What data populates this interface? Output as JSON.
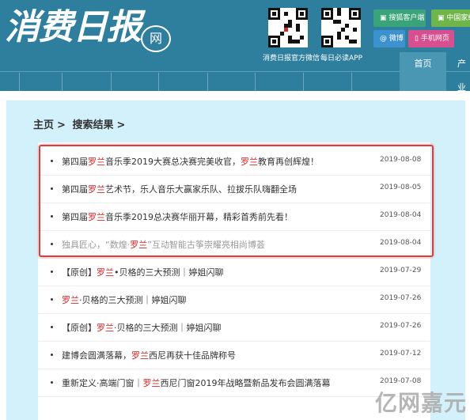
{
  "header": {
    "logo_text": "消费日报",
    "logo_badge": "网",
    "qr_codes": [
      {
        "caption": "消费日报官方微信"
      },
      {
        "caption": "每日必读APP"
      }
    ],
    "buttons": [
      {
        "label": "搜狐客户端",
        "icon": "sohu-client-icon",
        "color": "#3aa37a"
      },
      {
        "label": "中国家纺",
        "icon": "home-textile-icon",
        "color": "#6fb54a"
      },
      {
        "label": "微博",
        "icon": "weibo-icon",
        "color": "#3c92cf"
      },
      {
        "label": "手机网页",
        "icon": "mobile-icon",
        "color": "#d74f8e"
      }
    ],
    "nav": {
      "active_label": "首页",
      "next_label": "产业"
    }
  },
  "breadcrumb": {
    "home": "主页",
    "sep1": ">",
    "current": "搜索结果",
    "sep2": ">"
  },
  "results": [
    {
      "before": "第四届",
      "keyword": "罗兰",
      "middle": "音乐季2019大赛总决赛完美收官，",
      "keyword2": "罗兰",
      "after": "教育再创辉煌！",
      "date": "2019-08-08",
      "faded": false
    },
    {
      "before": "第四届",
      "keyword": "罗兰",
      "middle": "艺术节，乐人音乐大赢家乐队、拉拔乐队嗨翻全场",
      "keyword2": "",
      "after": "",
      "date": "2019-08-05",
      "faded": false
    },
    {
      "before": "第四届",
      "keyword": "罗兰",
      "middle": "音乐季2019总决赛华丽开幕，精彩首秀前先看！",
      "keyword2": "",
      "after": "",
      "date": "2019-08-04",
      "faded": false
    },
    {
      "before": "独具匠心，“数煌·",
      "keyword": "罗兰",
      "middle": "”互动智能古筝崇耀亮相尚博荟",
      "keyword2": "",
      "after": "",
      "date": "2019-08-04",
      "faded": true
    },
    {
      "before": "【原创】",
      "keyword": "罗兰",
      "middle": "•贝格的三大预测｜婷姐闪聊",
      "keyword2": "",
      "after": "",
      "date": "2019-07-29",
      "faded": false
    },
    {
      "before": "",
      "keyword": "罗兰",
      "middle": "·贝格的三大预测｜婷姐闪聊",
      "keyword2": "",
      "after": "",
      "date": "2019-07-26",
      "faded": false
    },
    {
      "before": "【原创】",
      "keyword": "罗兰",
      "middle": "·贝格的三大预测｜婷姐闪聊",
      "keyword2": "",
      "after": "",
      "date": "2019-07-26",
      "faded": false
    },
    {
      "before": "建博会圆满落幕，",
      "keyword": "罗兰",
      "middle": "西尼再获十佳品牌称号",
      "keyword2": "",
      "after": "",
      "date": "2019-07-12",
      "faded": false
    },
    {
      "before": "重新定义·高端门窗｜",
      "keyword": "罗兰",
      "middle": "西尼门窗2019年战略暨新品发布会圆满落幕",
      "keyword2": "",
      "after": "",
      "date": "2019-07-08",
      "faded": false
    }
  ],
  "watermark": "亿网嘉元",
  "colors": {
    "header_bg": "#2e7e9d",
    "panel_bg": "#d3f1fa",
    "keyword": "#d42828",
    "highlight_border": "#e23b3b"
  }
}
